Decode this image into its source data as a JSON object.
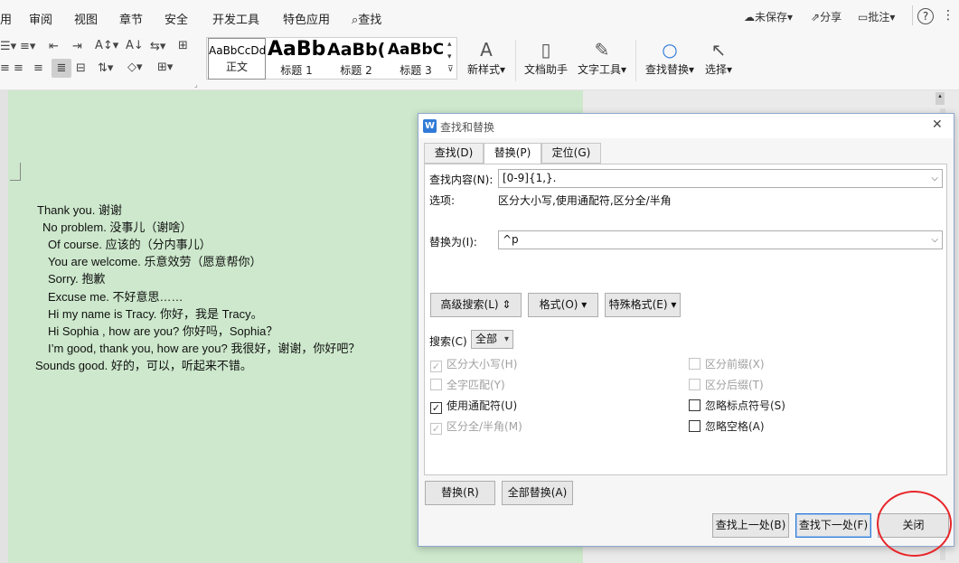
{
  "menu": {
    "items": [
      "用",
      "审阅",
      "视图",
      "章节",
      "安全",
      "开发工具",
      "特色应用"
    ],
    "search": "查找",
    "unsaved": "未保存",
    "share": "分享",
    "comment": "批注",
    "help": "?"
  },
  "ribbon": {
    "styles": [
      {
        "preview": "AaBbCcDd",
        "label": "正文"
      },
      {
        "preview": "AaBb",
        "label": "标题 1"
      },
      {
        "preview": "AaBb(",
        "label": "标题 2"
      },
      {
        "preview": "AaBbC",
        "label": "标题 3"
      }
    ],
    "tools": [
      {
        "label": "新样式",
        "icon": "new-style-icon",
        "glyph": "A"
      },
      {
        "label": "文档助手",
        "icon": "doc-assistant-icon",
        "glyph": "▯"
      },
      {
        "label": "文字工具",
        "icon": "wrench-icon",
        "glyph": "✎"
      },
      {
        "label": "查找替换",
        "icon": "magnifier-icon",
        "glyph": "○"
      },
      {
        "label": "选择",
        "icon": "cursor-icon",
        "glyph": "↖"
      }
    ]
  },
  "document": {
    "lines": [
      "Thank you. 谢谢",
      "No problem. 没事儿（谢啥）",
      "Of course. 应该的（分内事儿）",
      "You are welcome. 乐意效劳（愿意帮你）",
      "Sorry. 抱歉",
      "Excuse me. 不好意思……",
      "Hi my name is Tracy. 你好，我是 Tracy。",
      "Hi Sophia , how are you? 你好吗，Sophia？",
      "I’m good, thank you, how are you? 我很好，谢谢，你好吧？",
      "Sounds good. 好的，可以，听起来不错。"
    ]
  },
  "dialog": {
    "title": "查找和替换",
    "app_icon": "W",
    "close": "✕",
    "tabs": [
      "查找(D)",
      "替换(P)",
      "定位(G)"
    ],
    "find_label": "查找内容(N):",
    "find_value": "[0-9]{1,}.",
    "options_label": "选项:",
    "options_value": "区分大小写,使用通配符,区分全/半角",
    "replace_label": "替换为(I):",
    "replace_value": "^p",
    "advanced_button": "高级搜索(L)",
    "format_button": "格式(O)",
    "special_button": "特殊格式(E)",
    "search_label": "搜索(C)",
    "search_scope": "全部",
    "checkboxes_left": [
      {
        "label": "区分大小写(H)",
        "checked": true,
        "disabled": true
      },
      {
        "label": "全字匹配(Y)",
        "checked": false,
        "disabled": true
      },
      {
        "label": "使用通配符(U)",
        "checked": true,
        "disabled": false
      },
      {
        "label": "区分全/半角(M)",
        "checked": true,
        "disabled": true
      }
    ],
    "checkboxes_right": [
      {
        "label": "区分前缀(X)",
        "checked": false,
        "disabled": true
      },
      {
        "label": "区分后缀(T)",
        "checked": false,
        "disabled": true
      },
      {
        "label": "忽略标点符号(S)",
        "checked": false,
        "disabled": false
      },
      {
        "label": "忽略空格(A)",
        "checked": false,
        "disabled": false
      }
    ],
    "replace_button": "替换(R)",
    "replace_all_button": "全部替换(A)",
    "find_prev_button": "查找上一处(B)",
    "find_next_button": "查找下一处(F)",
    "close_button": "关闭"
  },
  "colors": {
    "page_bg": "#cde8cc",
    "annotation": "#e8262a",
    "accent": "#2f7ad7"
  }
}
